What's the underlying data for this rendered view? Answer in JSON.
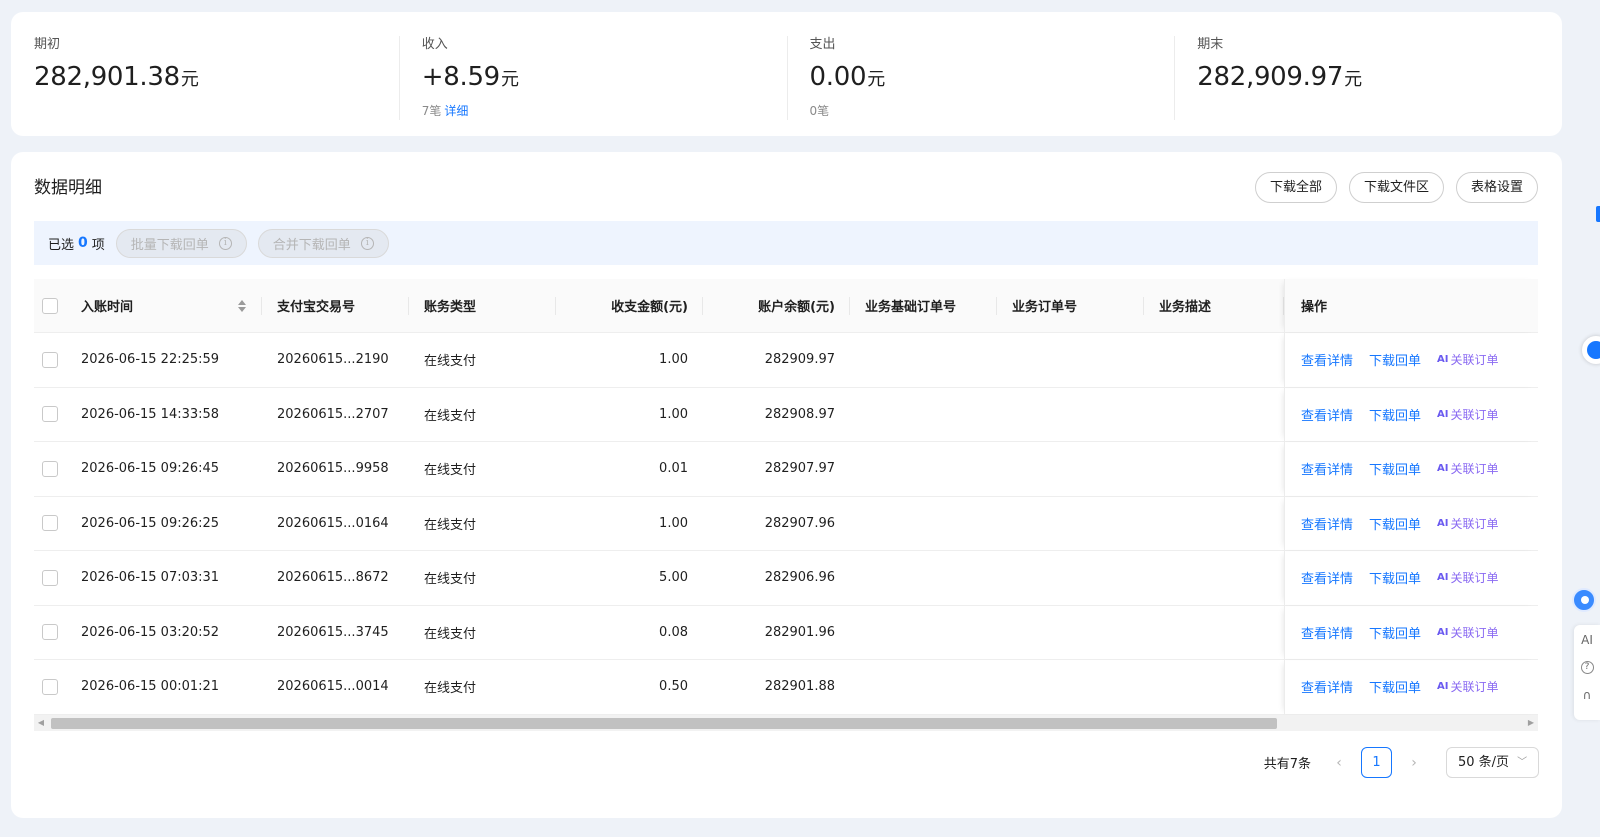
{
  "summary": [
    {
      "label": "期初",
      "value": "282,901.38",
      "unit": "元",
      "sub_count": "",
      "sub_link": ""
    },
    {
      "label": "收入",
      "value": "+8.59",
      "unit": "元",
      "sub_count": "7笔",
      "sub_link": "详细"
    },
    {
      "label": "支出",
      "value": "0.00",
      "unit": "元",
      "sub_count": "0笔",
      "sub_link": ""
    },
    {
      "label": "期末",
      "value": "282,909.97",
      "unit": "元",
      "sub_count": "",
      "sub_link": ""
    }
  ],
  "panel": {
    "title": "数据明细",
    "buttons": {
      "download_all": "下载全部",
      "download_files": "下载文件区",
      "table_settings": "表格设置"
    }
  },
  "selection": {
    "prefix": "已选",
    "count": "0",
    "suffix": "项",
    "batch_download": "批量下载回单",
    "merge_download": "合并下载回单"
  },
  "table": {
    "headers": {
      "time": "入账时间",
      "trade_no": "支付宝交易号",
      "type": "账务类型",
      "amount": "收支金额(元)",
      "balance": "账户余额(元)",
      "base_order": "业务基础订单号",
      "order": "业务订单号",
      "desc": "业务描述",
      "ops": "操作"
    },
    "ops": {
      "detail": "查看详情",
      "receipt": "下载回单",
      "link_order": "关联订单",
      "ai_icon": "AI"
    },
    "rows": [
      {
        "time": "2026-06-15 22:25:59",
        "trade_no": "20260615...2190",
        "type": "在线支付",
        "amount": "1.00",
        "balance": "282909.97"
      },
      {
        "time": "2026-06-15 14:33:58",
        "trade_no": "20260615...2707",
        "type": "在线支付",
        "amount": "1.00",
        "balance": "282908.97"
      },
      {
        "time": "2026-06-15 09:26:45",
        "trade_no": "20260615...9958",
        "type": "在线支付",
        "amount": "0.01",
        "balance": "282907.97"
      },
      {
        "time": "2026-06-15 09:26:25",
        "trade_no": "20260615...0164",
        "type": "在线支付",
        "amount": "1.00",
        "balance": "282907.96"
      },
      {
        "time": "2026-06-15 07:03:31",
        "trade_no": "20260615...8672",
        "type": "在线支付",
        "amount": "5.00",
        "balance": "282906.96"
      },
      {
        "time": "2026-06-15 03:20:52",
        "trade_no": "20260615...3745",
        "type": "在线支付",
        "amount": "0.08",
        "balance": "282901.96"
      },
      {
        "time": "2026-06-15 00:01:21",
        "trade_no": "20260615...0014",
        "type": "在线支付",
        "amount": "0.50",
        "balance": "282901.88"
      }
    ]
  },
  "pagination": {
    "total": "共有7条",
    "current_page": "1",
    "page_size": "50 条/页"
  },
  "side": {
    "ai": "AI"
  },
  "colors": {
    "accent": "#1677ff",
    "ai_purple": "#8a6af2",
    "page_bg": "#eef2f8"
  }
}
